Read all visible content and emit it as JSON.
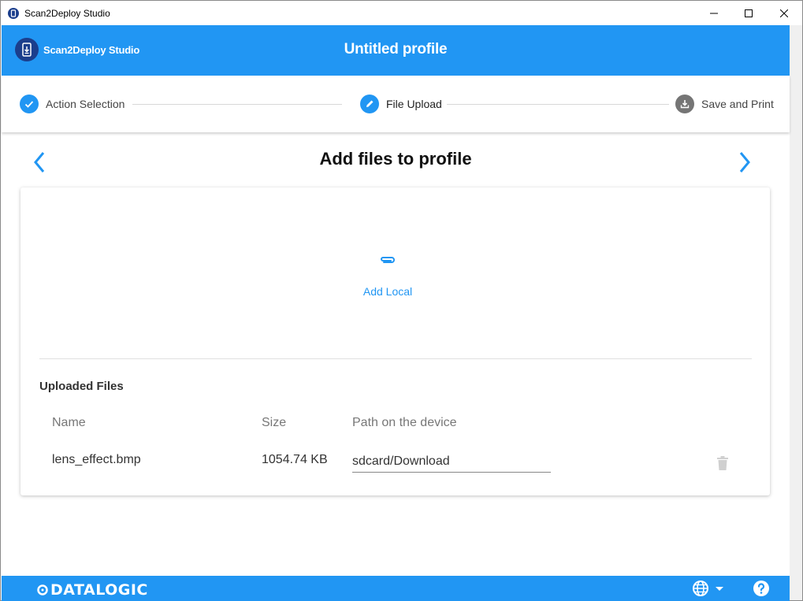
{
  "window": {
    "title": "Scan2Deploy Studio",
    "controls": {
      "minimize": "minimize",
      "maximize": "maximize",
      "close": "close"
    }
  },
  "header": {
    "brand_name": "Scan2Deploy Studio",
    "profile_title": "Untitled profile"
  },
  "stepper": {
    "steps": [
      {
        "label": "Action Selection",
        "state": "completed",
        "icon": "check-icon"
      },
      {
        "label": "File Upload",
        "state": "active",
        "icon": "pencil-icon"
      },
      {
        "label": "Save and Print",
        "state": "pending",
        "icon": "download-icon"
      }
    ]
  },
  "page": {
    "heading": "Add files to profile",
    "add_local_label": "Add Local",
    "uploaded_files_title": "Uploaded Files",
    "columns": [
      "Name",
      "Size",
      "Path on the device"
    ],
    "files": [
      {
        "name": "lens_effect.bmp",
        "size": "1054.74 KB",
        "path": "sdcard/Download"
      }
    ]
  },
  "footer": {
    "logo_text": "DATALOGIC",
    "language_icon": "globe-icon",
    "help_icon": "help-icon"
  },
  "colors": {
    "accent": "#2196f3",
    "brand_dark": "#1b3e8c",
    "pending_step": "#757575"
  }
}
